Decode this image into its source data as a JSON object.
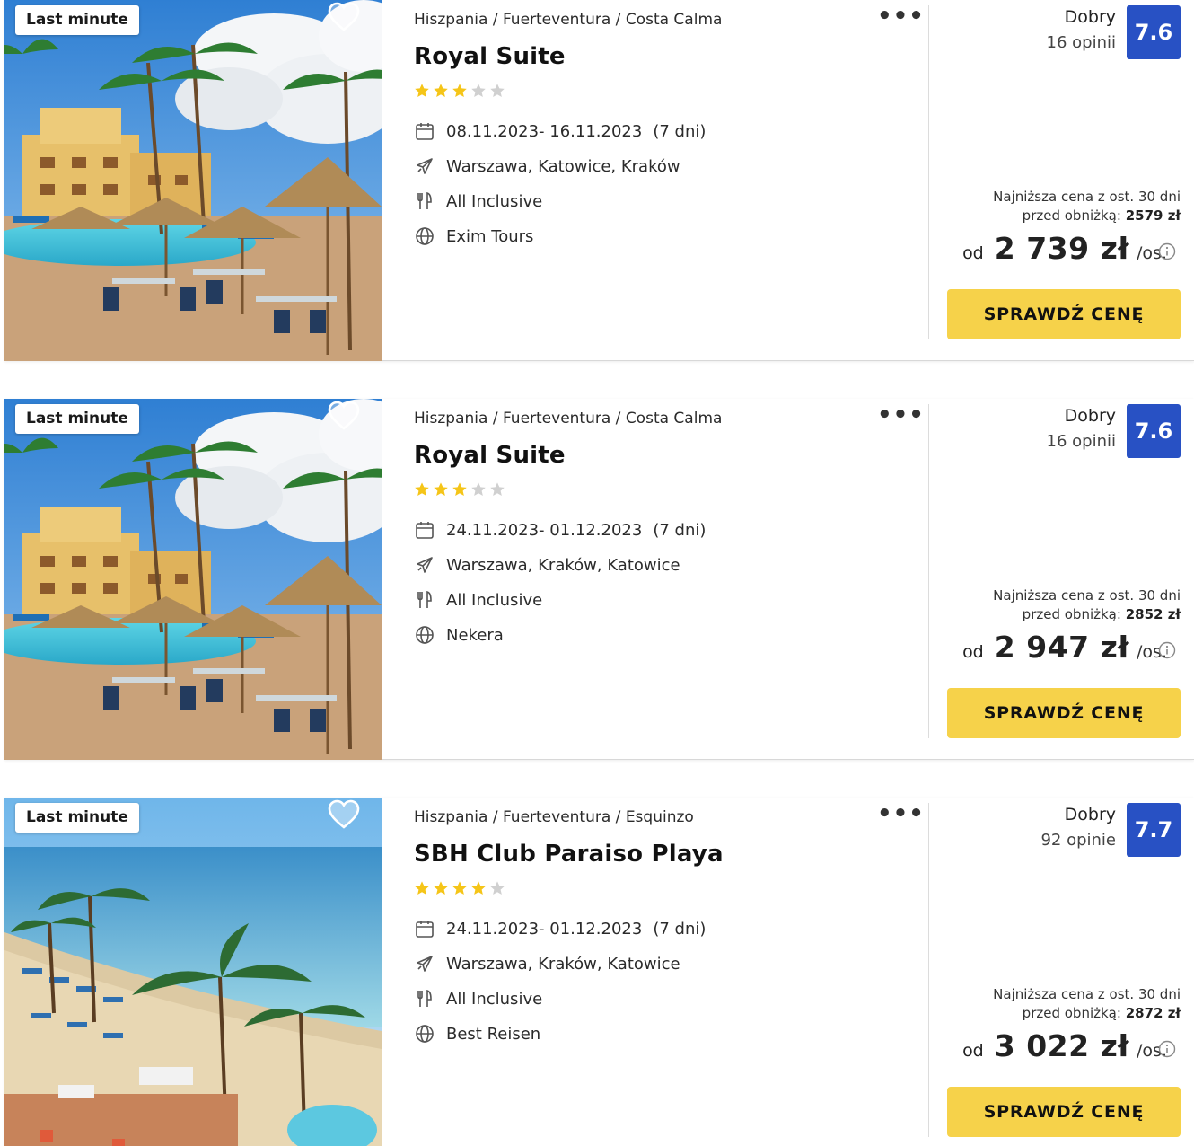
{
  "offers": [
    {
      "badge": "Last minute",
      "breadcrumb": "Hiszpania / Fuerteventura / Costa Calma",
      "name": "Royal Suite",
      "stars": 3,
      "dates": "08.11.2023- 16.11.2023",
      "duration": "(7 dni)",
      "departure": "Warszawa, Katowice, Kraków",
      "board": "All Inclusive",
      "operator": "Exim Tours",
      "rating_label": "Dobry",
      "review_count": "16 opinii",
      "score": "7.6",
      "lowest_line1": "Najniższa cena z ost. 30 dni",
      "lowest_prefix": "przed obniżką:",
      "lowest_price": "2579 zł",
      "price_prefix": "od",
      "price": "2 739 zł",
      "price_unit": "/os.",
      "cta": "SPRAWDŹ CENĘ",
      "photo": "pool-resort"
    },
    {
      "badge": "Last minute",
      "breadcrumb": "Hiszpania / Fuerteventura / Costa Calma",
      "name": "Royal Suite",
      "stars": 3,
      "dates": "24.11.2023- 01.12.2023",
      "duration": "(7 dni)",
      "departure": "Warszawa, Kraków, Katowice",
      "board": "All Inclusive",
      "operator": "Nekera",
      "rating_label": "Dobry",
      "review_count": "16 opinii",
      "score": "7.6",
      "lowest_line1": "Najniższa cena z ost. 30 dni",
      "lowest_prefix": "przed obniżką:",
      "lowest_price": "2852 zł",
      "price_prefix": "od",
      "price": "2 947 zł",
      "price_unit": "/os.",
      "cta": "SPRAWDŹ CENĘ",
      "photo": "pool-resort"
    },
    {
      "badge": "Last minute",
      "breadcrumb": "Hiszpania / Fuerteventura / Esquinzo",
      "name": "SBH Club Paraiso Playa",
      "stars": 4,
      "dates": "24.11.2023- 01.12.2023",
      "duration": "(7 dni)",
      "departure": "Warszawa, Kraków, Katowice",
      "board": "All Inclusive",
      "operator": "Best Reisen",
      "rating_label": "Dobry",
      "review_count": "92 opinie",
      "score": "7.7",
      "lowest_line1": "Najniższa cena z ost. 30 dni",
      "lowest_prefix": "przed obniżką:",
      "lowest_price": "2872 zł",
      "price_prefix": "od",
      "price": "3 022 zł",
      "price_unit": "/os.",
      "cta": "SPRAWDŹ CENĘ",
      "photo": "beach-resort"
    }
  ],
  "colors": {
    "score_bg": "#2851c4",
    "cta_bg": "#f6d24a",
    "star_on": "#f5c518",
    "star_off": "#d0d0d0"
  },
  "icons": {
    "favorite": "heart-icon",
    "more": "more-dots-icon",
    "date": "calendar-icon",
    "departure": "plane-icon",
    "board": "cutlery-icon",
    "operator": "globe-icon",
    "price_info": "info-icon"
  }
}
